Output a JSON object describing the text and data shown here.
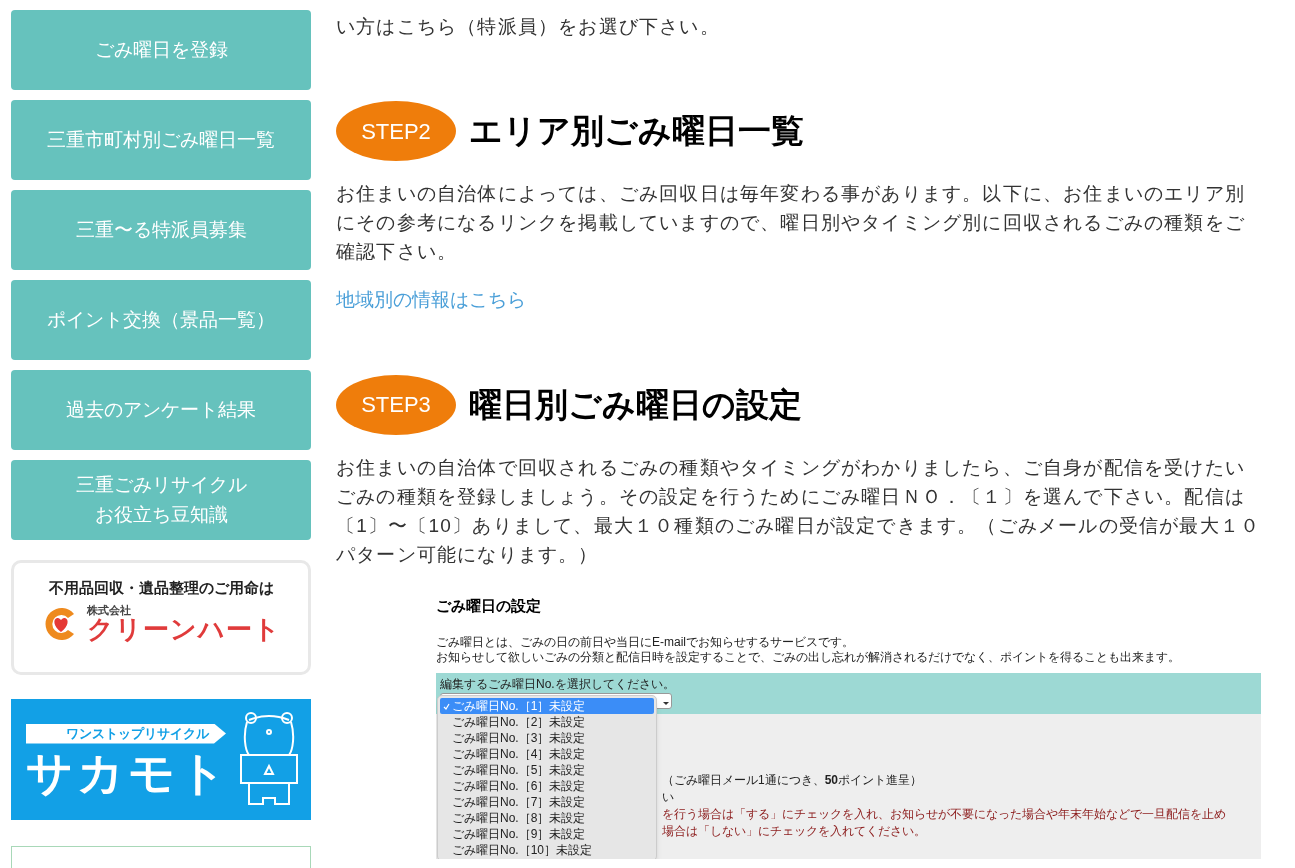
{
  "sidebar": {
    "items": [
      {
        "lines": [
          "ごみ曜日を登録"
        ]
      },
      {
        "lines": [
          "三重市町村別ごみ曜日一覧"
        ]
      },
      {
        "lines": [
          "三重〜る特派員募集"
        ]
      },
      {
        "lines": [
          "ポイント交換（景品一覧）"
        ]
      },
      {
        "lines": [
          "過去のアンケート結果"
        ]
      },
      {
        "lines": [
          "三重ごみリサイクル",
          "お役立ち豆知識"
        ]
      }
    ],
    "banners": [
      {
        "kind": "cleanheart",
        "caption": "不用品回収・遺品整理のご用命は",
        "company_type": "株式会社",
        "name": "クリーンハート"
      },
      {
        "kind": "sakamoto",
        "tagline": "ワンストップリサイクル",
        "name": "サカモト"
      },
      {
        "kind": "blank"
      }
    ]
  },
  "intro_tail": "い方はこちら（特派員）をお選び下さい。",
  "sections": [
    {
      "step": "STEP2",
      "heading": "エリア別ごみ曜日一覧",
      "body": "お住まいの自治体によっては、ごみ回収日は毎年変わる事があります。以下に、お住まいのエリア別にその参考になるリンクを掲載していますので、曜日別やタイミング別に回収されるごみの種類をご確認下さい。",
      "link": "地域別の情報はこちら"
    },
    {
      "step": "STEP3",
      "heading": "曜日別ごみ曜日の設定",
      "body": "お住まいの自治体で回収されるごみの種類やタイミングがわかりましたら、ご自身が配信を受けたいごみの種類を登録しましょう。その設定を行うためにごみ曜日ＮＯ．〔１〕を選んで下さい。配信は〔1〕〜〔10〕ありまして、最大１０種類のごみ曜日が設定できます。（ごみメールの受信が最大１０パターン可能になります。）"
    }
  ],
  "screenshot": {
    "title": "ごみ曜日の設定",
    "description": [
      "ごみ曜日とは、ごみの日の前日や当日にE-mailでお知らせするサービスです。",
      "お知らせして欲しいごみの分類と配信日時を設定することで、ごみの出し忘れが解消されるだけでなく、ポイントを得ることも出来ます。"
    ],
    "select_label": "編集するごみ曜日No.を選択してください。",
    "options": [
      {
        "label": "ごみ曜日No.［1］未設定",
        "selected": true
      },
      {
        "label": "ごみ曜日No.［2］未設定",
        "selected": false
      },
      {
        "label": "ごみ曜日No.［3］未設定",
        "selected": false
      },
      {
        "label": "ごみ曜日No.［4］未設定",
        "selected": false
      },
      {
        "label": "ごみ曜日No.［5］未設定",
        "selected": false
      },
      {
        "label": "ごみ曜日No.［6］未設定",
        "selected": false
      },
      {
        "label": "ごみ曜日No.［7］未設定",
        "selected": false
      },
      {
        "label": "ごみ曜日No.［8］未設定",
        "selected": false
      },
      {
        "label": "ごみ曜日No.［9］未設定",
        "selected": false
      },
      {
        "label": "ごみ曜日No.［10］未設定",
        "selected": false
      }
    ],
    "behind_lines": [
      {
        "kind": "normal",
        "text": "（ごみ曜日メール1通につき、**50**ポイント進呈）"
      },
      {
        "kind": "normal",
        "text": "い"
      },
      {
        "kind": "note",
        "text": "を行う場合は「する」にチェックを入れ、お知らせが不要になった場合や年末年始などで一旦配信を止め"
      },
      {
        "kind": "note",
        "text": "場合は「しない」にチェックを入れてください。"
      }
    ]
  }
}
